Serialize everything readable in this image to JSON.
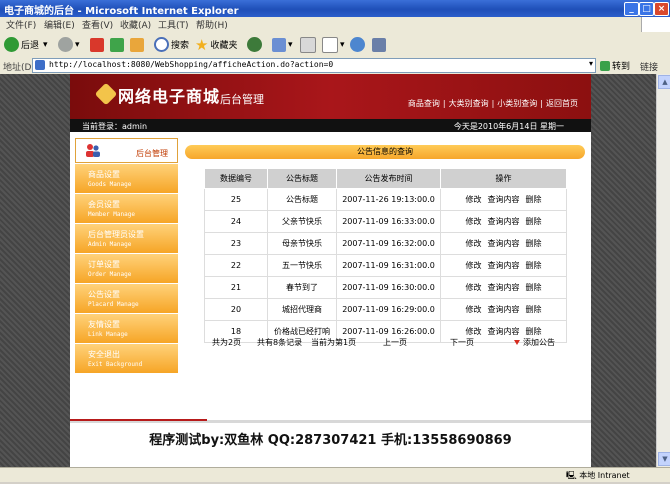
{
  "window": {
    "title": "电子商城的后台 - Microsoft Internet Explorer"
  },
  "menu": [
    "文件(F)",
    "编辑(E)",
    "查看(V)",
    "收藏(A)",
    "工具(T)",
    "帮助(H)"
  ],
  "toolbar": {
    "back": "后退",
    "search": "搜索",
    "favorites": "收藏夹"
  },
  "address": {
    "label": "地址(D)",
    "url": "http://localhost:8080/WebShopping/afficheAction.do?action=0",
    "go": "转到",
    "links": "链接"
  },
  "site": {
    "logo": "网络电子商城",
    "logo_sub": "后台管理",
    "nav": [
      "商品查询",
      "大类别查询",
      "小类别查询",
      "返回首页"
    ],
    "login": "当前登录：admin",
    "today": "今天是2010年6月14日  星期一"
  },
  "sidebar": {
    "title": "后台管理",
    "items": [
      {
        "cn": "商品设置",
        "en": "Goods Manage"
      },
      {
        "cn": "会员设置",
        "en": "Member Manage"
      },
      {
        "cn": "后台管理员设置",
        "en": "Admin Manage"
      },
      {
        "cn": "订单设置",
        "en": "Order Manage"
      },
      {
        "cn": "公告设置",
        "en": "Placard Manage"
      },
      {
        "cn": "友情设置",
        "en": "Link Manage"
      },
      {
        "cn": "安全退出",
        "en": "Exit Background"
      }
    ]
  },
  "main": {
    "title": "公告信息的查询",
    "columns": [
      "数据编号",
      "公告标题",
      "公告发布时间",
      "操作"
    ],
    "actions": [
      "修改",
      "查询内容",
      "删除"
    ],
    "rows": [
      {
        "id": "25",
        "title": "公告标题",
        "time": "2007-11-26 19:13:00.0"
      },
      {
        "id": "24",
        "title": "父亲节快乐",
        "time": "2007-11-09 16:33:00.0"
      },
      {
        "id": "23",
        "title": "母亲节快乐",
        "time": "2007-11-09 16:32:00.0"
      },
      {
        "id": "22",
        "title": "五一节快乐",
        "time": "2007-11-09 16:31:00.0"
      },
      {
        "id": "21",
        "title": "春节到了",
        "time": "2007-11-09 16:30:00.0"
      },
      {
        "id": "20",
        "title": "城招代理商",
        "time": "2007-11-09 16:29:00.0"
      },
      {
        "id": "18",
        "title": "价格战已经打响",
        "time": "2007-11-09 16:26:00.0"
      }
    ],
    "pager": {
      "total_pages": "共为2页",
      "total_records": "共有8条记录",
      "current": "当前为第1页",
      "prev": "上一页",
      "next": "下一页",
      "add": "添加公告"
    }
  },
  "footer": {
    "credit": "程序测试by:双鱼林  QQ:287307421  手机:13558690869"
  },
  "status": {
    "zone": "本地 Intranet"
  }
}
